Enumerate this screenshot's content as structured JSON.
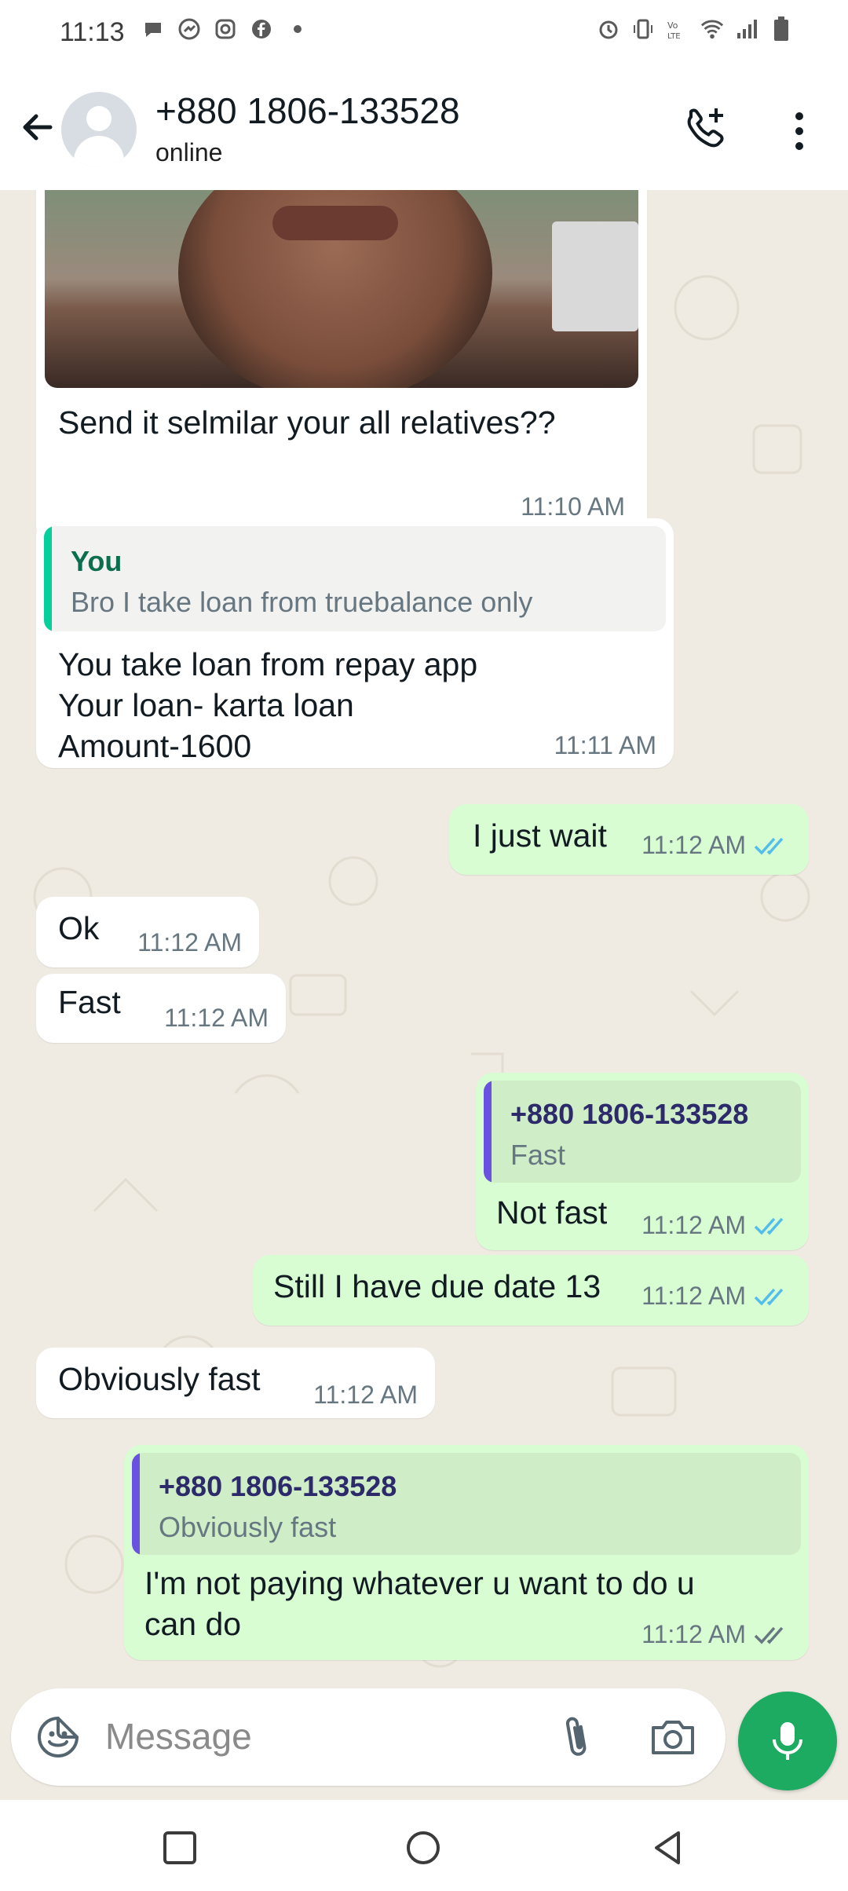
{
  "status_bar": {
    "time": "11:13",
    "left_icons": [
      "chat-bubble-icon",
      "messenger-icon",
      "instagram-icon",
      "facebook-icon",
      "dot-icon"
    ],
    "right_icons": [
      "alarm-icon",
      "vibrate-icon",
      "volte-icon",
      "wifi-icon",
      "signal-icon",
      "battery-icon"
    ]
  },
  "header": {
    "contact_name": "+880 1806-133528",
    "contact_status": "online"
  },
  "messages": [
    {
      "dir": "in",
      "text": "Send it selmilar your all relatives??",
      "time": "11:10 AM"
    },
    {
      "dir": "in",
      "quote_name": "You",
      "quote_text": "Bro I take loan from truebalance only",
      "lines": [
        "You take loan from repay app",
        "Your loan- karta loan",
        "Amount-1600"
      ],
      "time": "11:11 AM"
    },
    {
      "dir": "out",
      "text": "I just wait",
      "time": "11:12 AM",
      "status": "read"
    },
    {
      "dir": "in",
      "text": "Ok",
      "time": "11:12 AM"
    },
    {
      "dir": "in",
      "text": "Fast",
      "time": "11:12 AM"
    },
    {
      "dir": "out",
      "quote_name": "+880 1806-133528",
      "quote_text": "Fast",
      "text": "Not fast",
      "time": "11:12 AM",
      "status": "read"
    },
    {
      "dir": "out",
      "text": "Still I have due date 13",
      "time": "11:12 AM",
      "status": "read"
    },
    {
      "dir": "in",
      "text": "Obviously fast",
      "time": "11:12 AM"
    },
    {
      "dir": "out",
      "quote_name": "+880 1806-133528",
      "quote_text": "Obviously fast",
      "lines": [
        "I'm not paying whatever u want to do u",
        "can do"
      ],
      "time": "11:12 AM",
      "status": "delivered"
    }
  ],
  "composer": {
    "placeholder": "Message"
  },
  "colors": {
    "chat_bg": "#efeae2",
    "incoming": "#ffffff",
    "outgoing": "#d9fdd3",
    "accent_green": "#1daa61",
    "read_tick": "#53bdeb",
    "quote_you": "#06cf9c",
    "quote_contact": "#6a52e0"
  }
}
